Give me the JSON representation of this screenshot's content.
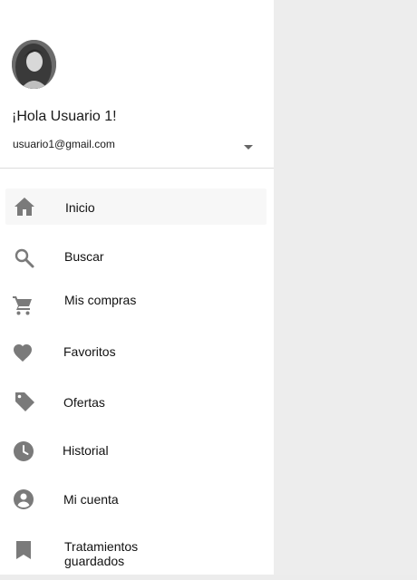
{
  "header": {
    "greeting": "¡Hola Usuario 1!",
    "email": "usuario1@gmail.com"
  },
  "menu": {
    "items": [
      {
        "label": "Inicio",
        "icon": "home-icon",
        "active": true
      },
      {
        "label": "Buscar",
        "icon": "search-icon"
      },
      {
        "label": "Mis compras",
        "icon": "shopping-cart-icon"
      },
      {
        "label": "Favoritos",
        "icon": "heart-icon"
      },
      {
        "label": "Ofertas",
        "icon": "tag-icon"
      },
      {
        "label": "Historial",
        "icon": "clock-icon"
      },
      {
        "label": "Mi cuenta",
        "icon": "account-circle-icon"
      },
      {
        "label": "Tratamientos guardados",
        "icon": "bookmark-icon"
      }
    ]
  },
  "colors": {
    "icon": "#7a7a7a",
    "drawer_bg": "#ffffff",
    "page_bg": "#ededed"
  }
}
